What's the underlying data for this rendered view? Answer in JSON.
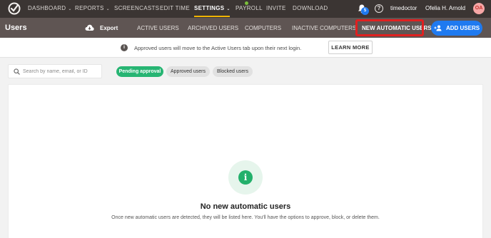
{
  "topnav": {
    "items": [
      {
        "label": "DASHBOARD",
        "has_caret": true
      },
      {
        "label": "REPORTS",
        "has_caret": true
      },
      {
        "label": "SCREENCASTS",
        "has_caret": false
      },
      {
        "label": "EDIT TIME",
        "has_caret": false
      },
      {
        "label": "SETTINGS",
        "has_caret": true,
        "active": true
      },
      {
        "label": "PAYROLL",
        "has_caret": false
      },
      {
        "label": "INVITE",
        "has_caret": false
      },
      {
        "label": "DOWNLOAD",
        "has_caret": false
      }
    ],
    "caret": "⌄",
    "notification_count": "5",
    "help_glyph": "?",
    "company": "timedoctor",
    "username": "Ofelia H. Arnold",
    "avatar_initials": "OA",
    "accent_color": "#f0b400"
  },
  "subheader": {
    "title": "Users",
    "export_label": "Export",
    "tabs": [
      {
        "label": "ACTIVE USERS"
      },
      {
        "label": "ARCHIVED USERS"
      },
      {
        "label": "COMPUTERS"
      },
      {
        "label": "INACTIVE COMPUTERS"
      },
      {
        "label": "NEW AUTOMATIC USERS",
        "active": true
      }
    ],
    "add_users_label": "ADD USERS",
    "highlight_color": "#e02020"
  },
  "banner": {
    "info_glyph": "i",
    "text": "Approved users will move to the Active Users tab upon their next login.",
    "learn_more_label": "LEARN MORE"
  },
  "filters": {
    "search_placeholder": "Search by name, email, or ID",
    "search_value": "",
    "pills": [
      {
        "label": "Pending approval",
        "active": true
      },
      {
        "label": "Approved users",
        "active": false
      },
      {
        "label": "Blocked users",
        "active": false
      }
    ]
  },
  "empty_state": {
    "icon_glyph": "i",
    "title": "No new automatic users",
    "description": "Once new automatic users are detected, they will be listed here. You'll have the options to approve, block, or delete them."
  },
  "colors": {
    "primary_blue": "#1f7af0",
    "success_green": "#27b573",
    "nav_bg": "#3b3533",
    "subheader_bg": "#5f5553"
  }
}
